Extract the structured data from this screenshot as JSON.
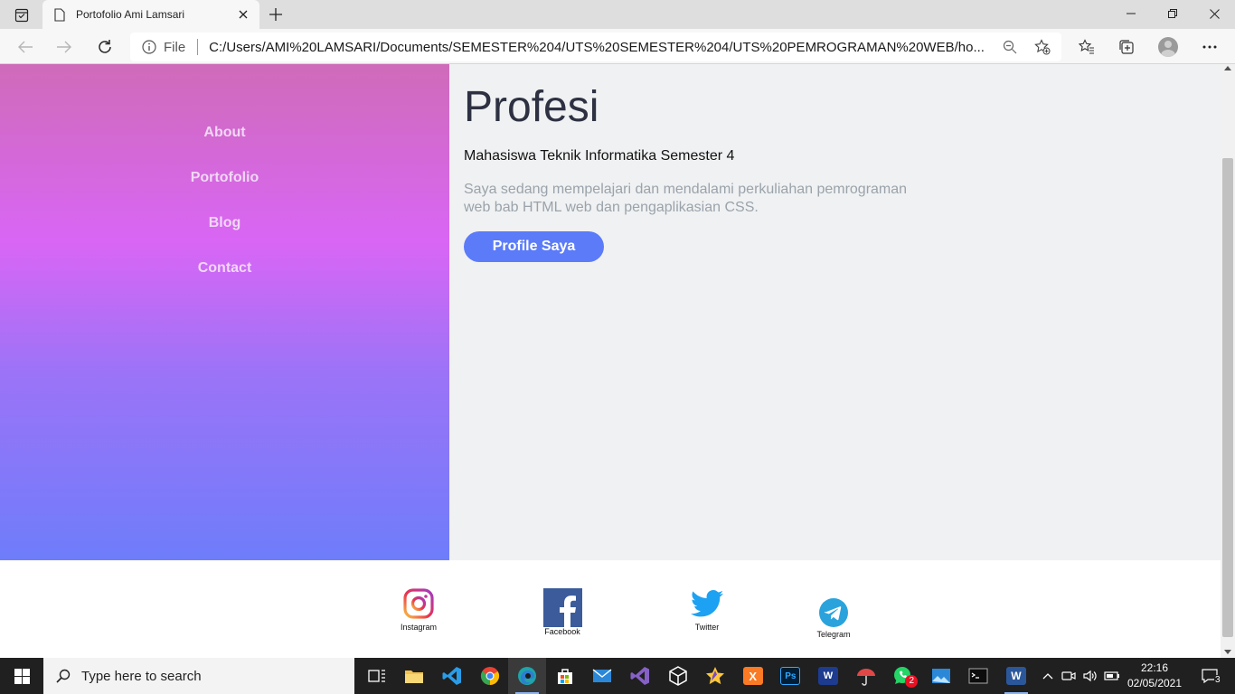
{
  "browser": {
    "tab_title": "Portofolio Ami Lamsari",
    "address_scheme_label": "File",
    "address_url": "C:/Users/AMI%20LAMSARI/Documents/SEMESTER%204/UTS%20SEMESTER%204/UTS%20PEMROGRAMAN%20WEB/ho..."
  },
  "nav": {
    "items": [
      {
        "label": "About"
      },
      {
        "label": "Portofolio"
      },
      {
        "label": "Blog"
      },
      {
        "label": "Contact"
      }
    ]
  },
  "main": {
    "title": "Profesi",
    "subtitle": "Mahasiswa Teknik Informatika Semester 4",
    "description": "Saya sedang mempelajari dan mendalami perkuliahan pemrograman web bab HTML web dan pengaplikasian CSS.",
    "button_label": "Profile Saya"
  },
  "footer": {
    "social": [
      {
        "label": "Instagram",
        "icon": "instagram-icon"
      },
      {
        "label": "Facebook",
        "icon": "facebook-icon"
      },
      {
        "label": "Twitter",
        "icon": "twitter-icon"
      },
      {
        "label": "Telegram",
        "icon": "telegram-icon"
      }
    ]
  },
  "taskbar": {
    "search_placeholder": "Type here to search",
    "time": "22:16",
    "date": "02/05/2021",
    "whatsapp_badge": "2",
    "notification_count": "3"
  },
  "colors": {
    "sidebar_gradient": [
      "#cf6bb9",
      "#d966f5",
      "#9c73f7",
      "#6e7dfb"
    ],
    "button": "#5b7bf9",
    "main_bg": "#f0f1f2"
  }
}
